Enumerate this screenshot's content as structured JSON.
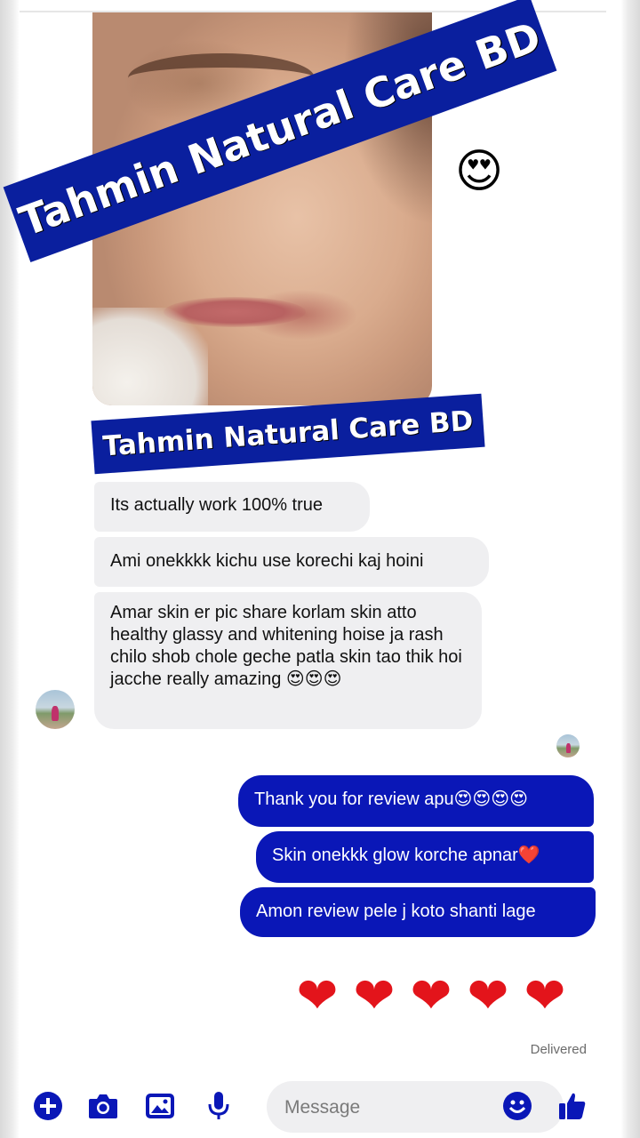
{
  "colors": {
    "accent": "#0a17b7",
    "banner": "#0a1f9e",
    "received_bubble": "#efeff1",
    "heart": "#e3141b"
  },
  "watermark": {
    "top_text": "Tahmin Natural Care BD",
    "bottom_text": "Tahmin Natural Care BD"
  },
  "photo": {
    "reaction_emoji": "😍"
  },
  "received_messages": [
    "Its actually work 100% true",
    "Ami onekkkk kichu use korechi kaj hoini",
    "Amar skin er pic share korlam skin atto healthy glassy and whitening hoise ja rash chilo shob chole geche patla skin tao thik hoi jacche really amazing 😍😍😍"
  ],
  "sent_messages": [
    "Thank you for review apu😍😍😍😍",
    "Skin onekkk glow korche apnar❤️",
    "Amon review pele j koto shanti lage"
  ],
  "hearts": [
    "❤",
    "❤",
    "❤",
    "❤",
    "❤"
  ],
  "status": {
    "delivered": "Delivered"
  },
  "composer": {
    "placeholder": "Message",
    "icons": [
      "plus-icon",
      "camera-icon",
      "image-icon",
      "microphone-icon",
      "emoji-icon",
      "thumbs-up-icon"
    ]
  }
}
